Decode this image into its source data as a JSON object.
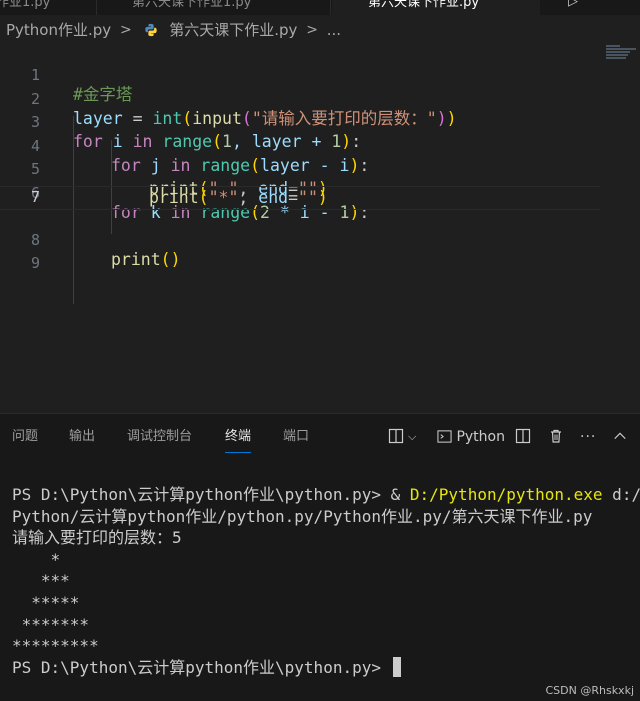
{
  "tabs": [
    {
      "label": "作业1.py",
      "active": false
    },
    {
      "label": "第六天课下作业1.py",
      "active": false
    },
    {
      "label": "第六天课下作业.py",
      "active": true
    }
  ],
  "breadcrumb": {
    "folder": "Python作业.py",
    "file": "第六天课下作业.py",
    "more": "..."
  },
  "editor": {
    "line_numbers": [
      "1",
      "2",
      "3",
      "4",
      "5",
      "6",
      "7",
      "8",
      "9"
    ],
    "current_line": 7,
    "code": {
      "l1_comment": "#金字塔",
      "l2_var": "layer",
      "l2_eq": " = ",
      "l2_int": "int",
      "l2_p1": "(",
      "l2_input": "input",
      "l2_p2": "(",
      "l2_str": "\"请输入要打印的层数：\"",
      "l2_p2c": ")",
      "l2_p1c": ")",
      "l3_for": "for",
      "l3_i": " i ",
      "l3_in": "in",
      "l3_range": " range",
      "l3_p": "(",
      "l3_one": "1",
      "l3_mid": ", layer + ",
      "l3_one2": "1",
      "l3_pc": ")",
      "l3_colon": ":",
      "l4_for": "for",
      "l4_j": " j ",
      "l4_in": "in",
      "l4_range": " range",
      "l4_p": "(",
      "l4_args": "layer - i",
      "l4_pc": ")",
      "l4_colon": ":",
      "l5_print": "print",
      "l5_p": "(",
      "l5_s1": "\" \"",
      "l5_mid": ", ",
      "l5_end": "end",
      "l5_eq": "=",
      "l5_s2": "\"\"",
      "l5_pc": ")",
      "l6_for": "for",
      "l6_k": " k ",
      "l6_in": "in",
      "l6_range": " range",
      "l6_p": "(",
      "l6_two": "2",
      "l6_mid": " * i - ",
      "l6_one": "1",
      "l6_pc": ")",
      "l6_colon": ":",
      "l7_print": "print",
      "l7_p": "(",
      "l7_s1": "\"*\"",
      "l7_mid": ", ",
      "l7_end": "end",
      "l7_eq": "=",
      "l7_s2": "\"\"",
      "l7_pc": ")",
      "l8_print": "print",
      "l8_p": "()"
    }
  },
  "panel": {
    "tabs": [
      "问题",
      "输出",
      "调试控制台",
      "终端",
      "端口"
    ],
    "active_tab": "终端",
    "terminal_label": "Python",
    "terminal": {
      "prompt1": "PS D:\\Python\\云计算python作业\\python.py> ",
      "amp": "& ",
      "exe": "D:/Python/python.exe",
      "arg1": " d:/",
      "arg2": "Python/云计算python作业/python.py/Python作业.py/第六天课下作业.py",
      "question": "请输入要打印的层数：5",
      "rows": [
        "    *",
        "   ***",
        "  *****",
        " *******",
        "*********"
      ],
      "prompt2": "PS D:\\Python\\云计算python作业\\python.py> "
    }
  },
  "watermark": "CSDN @Rhskxkj",
  "colors": {
    "editor_bg": "#1f1f1f",
    "panel_bg": "#181818",
    "accent": "#0078d4",
    "keyword": "#569cd6",
    "control": "#c586c0",
    "string": "#ce9178",
    "function": "#dcdcaa",
    "comment": "#6a9955"
  }
}
